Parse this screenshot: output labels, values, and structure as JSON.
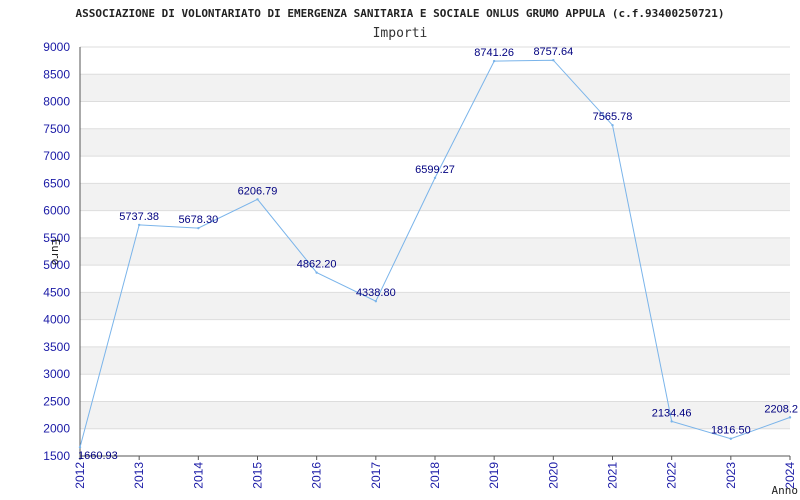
{
  "chart_data": {
    "type": "line",
    "title": "ASSOCIAZIONE DI VOLONTARIATO DI EMERGENZA SANITARIA E SOCIALE ONLUS GRUMO APPULA (c.f.93400250721)",
    "subtitle": "Importi",
    "xlabel": "Anno",
    "ylabel": "Euro",
    "categories": [
      "2012",
      "2013",
      "2014",
      "2015",
      "2016",
      "2017",
      "2018",
      "2019",
      "2020",
      "2021",
      "2022",
      "2023",
      "2024"
    ],
    "series": [
      {
        "values": [
          1660.93,
          5737.38,
          5678.3,
          6206.79,
          4862.2,
          4338.8,
          6599.27,
          8741.26,
          8757.64,
          7565.78,
          2134.46,
          1816.5,
          2208.2
        ],
        "labels": [
          "1660.93",
          "5737.38",
          "5678.30",
          "6206.79",
          "4862.20",
          "4338.80",
          "6599.27",
          "8741.26",
          "8757.64",
          "7565.78",
          "2134.46",
          "1816.50",
          "2208.2"
        ]
      }
    ],
    "ylim": [
      1500,
      9000
    ],
    "yticks": [
      "9000",
      "8500",
      "8000",
      "7500",
      "7000",
      "6500",
      "6000",
      "5500",
      "5000",
      "4500",
      "4000",
      "3500",
      "3000",
      "2500",
      "2000",
      "1500"
    ],
    "grid": true,
    "colors": {
      "line": "#7ab4ea",
      "band": "#f2f2f2",
      "gridline": "#dddddd",
      "axis": "#555555",
      "tick_text": "#1a1aa6",
      "label_text": "#000080"
    }
  }
}
